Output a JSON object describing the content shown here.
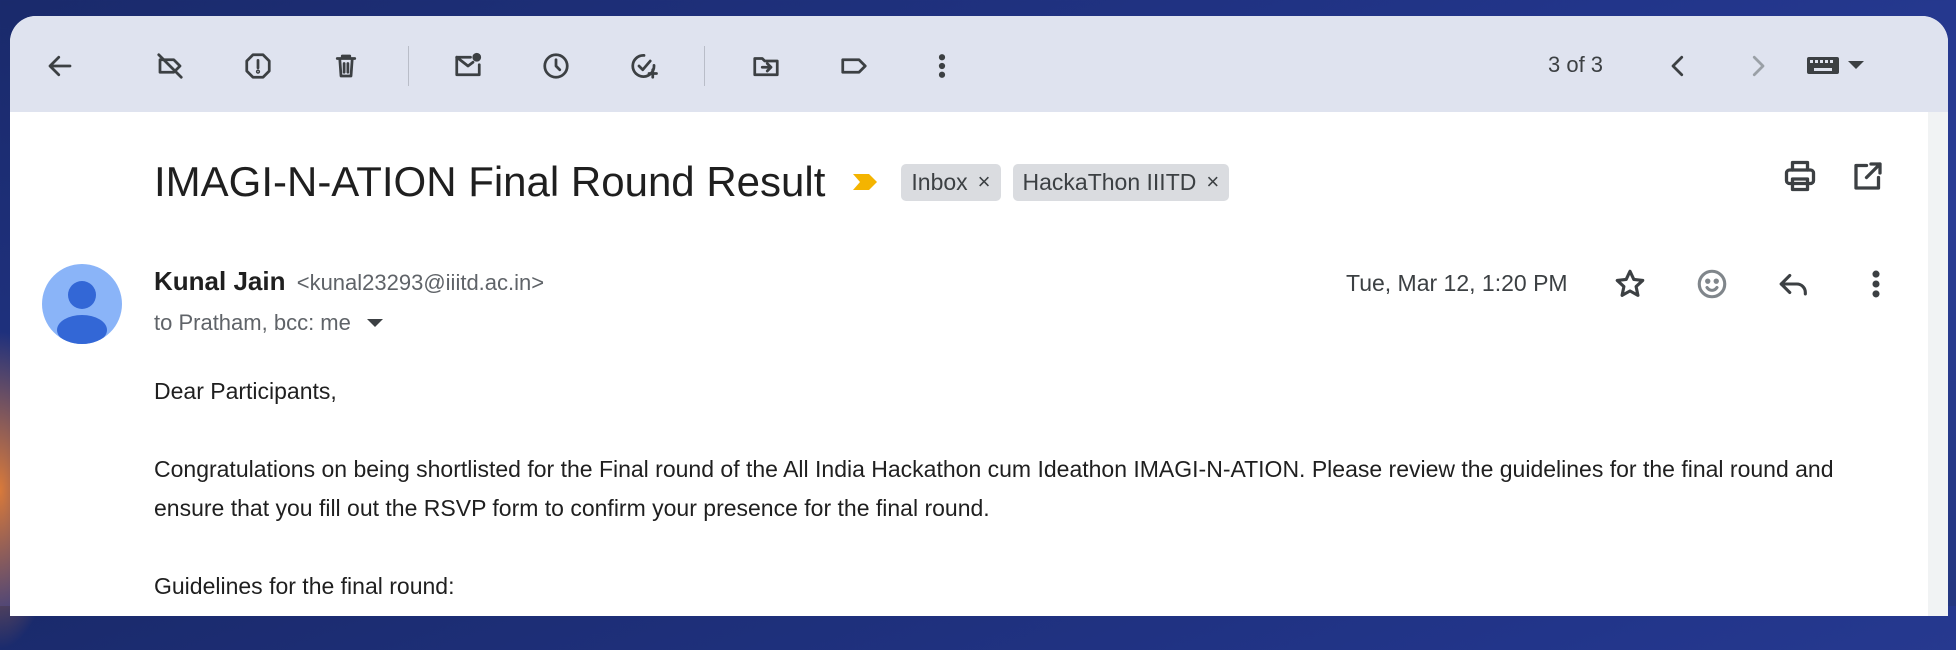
{
  "toolbar": {
    "pager_text": "3 of 3"
  },
  "email": {
    "subject": "IMAGI-N-ATION Final Round Result",
    "labels": [
      "Inbox",
      "HackaThon IIITD"
    ],
    "sender_name": "Kunal Jain",
    "sender_email": "<kunal23293@iiitd.ac.in>",
    "recipients": "to Pratham, bcc: me",
    "date": "Tue, Mar 12, 1:20 PM",
    "body": {
      "greeting": "Dear Participants,",
      "paragraph1": "Congratulations on being shortlisted for the Final round of the All India Hackathon cum Ideathon IMAGI-N-ATION. Please review the guidelines for the final round and ensure that you fill out the RSVP form to confirm your presence for the final round.",
      "guidelines_heading": "Guidelines for the final round:"
    }
  },
  "icons": {
    "back": "arrow-left-icon",
    "mark_unread": "mark-unread-icon",
    "snooze": "clock-icon",
    "add_task": "add-task-icon",
    "move": "move-to-icon",
    "label": "label-icon",
    "more": "more-vert-icon",
    "print": "print-icon",
    "open_new": "open-in-new-icon",
    "star": "star-icon",
    "emoji": "emoji-icon",
    "reply": "reply-icon",
    "keyboard": "keyboard-icon"
  },
  "colors": {
    "toolbar_bg": "#dfe3ef",
    "importance": "#f4b400",
    "avatar": "#8ab4f8",
    "avatar_figure": "#3367d6",
    "chip_bg": "#dadce0"
  }
}
